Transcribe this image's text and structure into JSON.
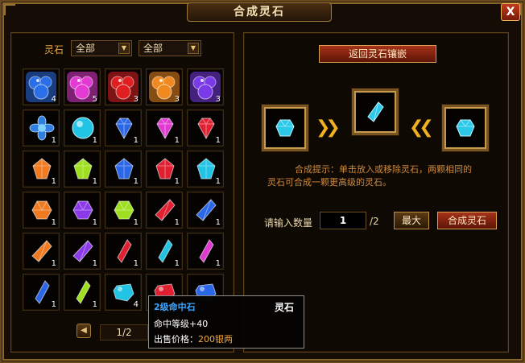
{
  "window": {
    "title": "合成灵石",
    "close_label": "X"
  },
  "filters": {
    "label": "灵石",
    "dropdown1": "全部",
    "dropdown2": "全部"
  },
  "inventory": {
    "slots": [
      {
        "gem": "blue-cluster",
        "color": "#2a6ee8",
        "count": "4"
      },
      {
        "gem": "magenta-cluster",
        "color": "#e23ad2",
        "count": "5"
      },
      {
        "gem": "red-cluster",
        "color": "#e02020",
        "count": "3"
      },
      {
        "gem": "orange-cluster",
        "color": "#f08a20",
        "count": "3"
      },
      {
        "gem": "purple-cluster",
        "color": "#7a3ae8",
        "count": "3"
      },
      {
        "gem": "blue-flower",
        "color": "#2f7ee0",
        "count": "1"
      },
      {
        "gem": "cyan-orb",
        "color": "#22c4e6",
        "count": "1"
      },
      {
        "gem": "blue-diamond",
        "color": "#2a66e8",
        "count": "1"
      },
      {
        "gem": "magenta-diamond",
        "color": "#e03ad0",
        "count": "1"
      },
      {
        "gem": "red-diamond",
        "color": "#e02030",
        "count": "1"
      },
      {
        "gem": "orange-crystal",
        "color": "#f07a20",
        "count": "1"
      },
      {
        "gem": "lime-crystal",
        "color": "#9ee020",
        "count": "1"
      },
      {
        "gem": "blue-crystal",
        "color": "#2a66e8",
        "count": "1"
      },
      {
        "gem": "red-crystal",
        "color": "#e02030",
        "count": "1"
      },
      {
        "gem": "cyan-crystal",
        "color": "#22c4e6",
        "count": "1"
      },
      {
        "gem": "orange-gem",
        "color": "#f07a20",
        "count": "1"
      },
      {
        "gem": "purple-gem",
        "color": "#8a3ae8",
        "count": "1"
      },
      {
        "gem": "lime-gem",
        "color": "#9ee020",
        "count": "1"
      },
      {
        "gem": "red-shard",
        "color": "#e02030",
        "count": "1"
      },
      {
        "gem": "blue-shard",
        "color": "#2a66e8",
        "count": "1"
      },
      {
        "gem": "orange-shard",
        "color": "#f07a20",
        "count": "1"
      },
      {
        "gem": "purple-shard",
        "color": "#8a3ae8",
        "count": "1"
      },
      {
        "gem": "red-sliver",
        "color": "#e02030",
        "count": "1"
      },
      {
        "gem": "cyan-sliver",
        "color": "#22c4e6",
        "count": "1"
      },
      {
        "gem": "magenta-sliver",
        "color": "#e03ad0",
        "count": "1"
      },
      {
        "gem": "blue-sliver",
        "color": "#2a66e8",
        "count": "1"
      },
      {
        "gem": "lime-sliver",
        "color": "#9ee020",
        "count": "1"
      },
      {
        "gem": "cyan-pebble",
        "color": "#22c4e6",
        "count": "4"
      },
      {
        "gem": "red-pebble",
        "color": "#e02030",
        "count": ""
      },
      {
        "gem": "blue-pebble",
        "color": "#2a66e8",
        "count": ""
      }
    ],
    "page": "1/2"
  },
  "synthesis": {
    "return_button": "返回灵石镶嵌",
    "hint_line1": "合成提示：单击放入或移除灵石，两颗相同的",
    "hint_line2": "灵石可合成一颗更高级的灵石。",
    "qty_label": "请输入数量",
    "qty_value": "1",
    "qty_total": "/2",
    "max_button": "最大",
    "combine_button": "合成灵石"
  },
  "tooltip": {
    "name": "2级命中石",
    "type": "灵石",
    "attr": "命中等级+40",
    "price_label": "出售价格：",
    "price_value": "200银两"
  }
}
